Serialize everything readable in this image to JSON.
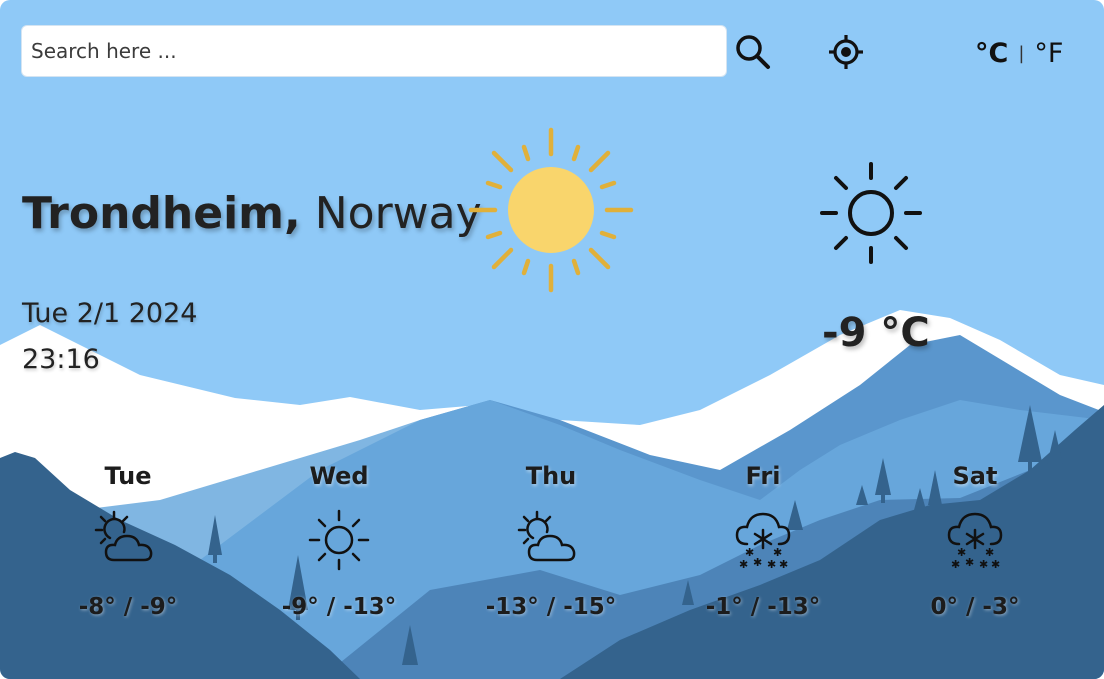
{
  "search": {
    "placeholder": "Search here ..."
  },
  "units": {
    "celsius": "°C",
    "separator": "|",
    "fahrenheit": "°F",
    "selected": "celsius"
  },
  "location": {
    "city": "Trondheim,",
    "country": "Norway"
  },
  "datetime": {
    "date": "Tue 2/1 2024",
    "time": "23:16"
  },
  "current": {
    "temperature": "-9 °C",
    "icon": "sun-icon"
  },
  "forecast": [
    {
      "day": "Tue",
      "icon": "partly-cloudy-icon",
      "temp": "-8° / -9°"
    },
    {
      "day": "Wed",
      "icon": "sun-icon",
      "temp": "-9° / -13°"
    },
    {
      "day": "Thu",
      "icon": "partly-cloudy-icon",
      "temp": "-13° / -15°"
    },
    {
      "day": "Fri",
      "icon": "snow-icon",
      "temp": "-1° / -13°"
    },
    {
      "day": "Sat",
      "icon": "snow-icon",
      "temp": "0° / -3°"
    }
  ],
  "colors": {
    "sky": "#8fc9f7",
    "snow": "#ffffff",
    "mountain_light": "#6aa9dd",
    "mountain_mid": "#5190c8",
    "mountain_dark": "#34638d",
    "sun": "#f9d56c",
    "sun_rays": "#e0b03a"
  }
}
